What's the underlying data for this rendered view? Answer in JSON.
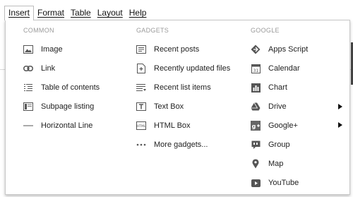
{
  "menubar": {
    "items": [
      {
        "label": "Insert"
      },
      {
        "label": "Format"
      },
      {
        "label": "Table"
      },
      {
        "label": "Layout"
      },
      {
        "label": "Help"
      }
    ]
  },
  "dropdown": {
    "columns": [
      {
        "header": "COMMON",
        "items": [
          {
            "label": "Image",
            "icon": "image-icon"
          },
          {
            "label": "Link",
            "icon": "link-icon"
          },
          {
            "label": "Table of contents",
            "icon": "table-of-contents-icon"
          },
          {
            "label": "Subpage listing",
            "icon": "subpage-listing-icon"
          },
          {
            "label": "Horizontal Line",
            "icon": "horizontal-line-icon"
          }
        ]
      },
      {
        "header": "GADGETS",
        "items": [
          {
            "label": "Recent posts",
            "icon": "recent-posts-icon"
          },
          {
            "label": "Recently updated files",
            "icon": "recently-updated-files-icon"
          },
          {
            "label": "Recent list items",
            "icon": "recent-list-items-icon"
          },
          {
            "label": "Text Box",
            "icon": "text-box-icon"
          },
          {
            "label": "HTML Box",
            "icon": "html-box-icon"
          },
          {
            "label": "More gadgets...",
            "icon": "more-gadgets-icon"
          }
        ]
      },
      {
        "header": "GOOGLE",
        "items": [
          {
            "label": "Apps Script",
            "icon": "apps-script-icon"
          },
          {
            "label": "Calendar",
            "icon": "calendar-icon"
          },
          {
            "label": "Chart",
            "icon": "chart-icon"
          },
          {
            "label": "Drive",
            "icon": "drive-icon",
            "submenu": true
          },
          {
            "label": "Google+",
            "icon": "google-plus-icon",
            "submenu": true
          },
          {
            "label": "Group",
            "icon": "group-icon"
          },
          {
            "label": "Map",
            "icon": "map-icon"
          },
          {
            "label": "YouTube",
            "icon": "youtube-icon"
          }
        ]
      }
    ]
  },
  "colors": {
    "header_text": "#9a9a9a",
    "item_text": "#222222",
    "icon": "#555555"
  }
}
